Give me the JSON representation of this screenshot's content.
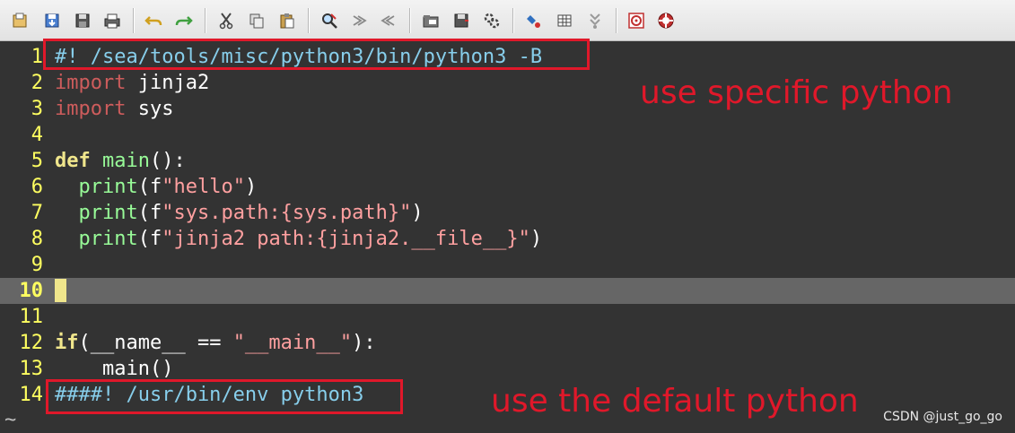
{
  "toolbar": {
    "icons": [
      "open-icon",
      "save-icon",
      "save-all-icon",
      "print-icon",
      "undo-icon",
      "redo-icon",
      "cut-icon",
      "copy-icon",
      "paste-icon",
      "find-replace-icon",
      "find-next-icon",
      "find-prev-icon",
      "load-session-icon",
      "save-session-icon",
      "run-script-icon",
      "make-icon",
      "ctags-icon",
      "jump-tag-icon",
      "help-icon",
      "find-help-icon"
    ]
  },
  "editor": {
    "cursor_line": 10,
    "lines": [
      {
        "n": "1",
        "tokens": [
          {
            "t": "#!",
            "c": "com"
          },
          {
            "t": " /sea/tools/misc/python3/bin/python3 -B",
            "c": "com"
          }
        ]
      },
      {
        "n": "2",
        "tokens": [
          {
            "t": "import",
            "c": "pp"
          },
          {
            "t": " jinja2",
            "c": "punct"
          }
        ]
      },
      {
        "n": "3",
        "tokens": [
          {
            "t": "import",
            "c": "pp"
          },
          {
            "t": " sys",
            "c": "punct"
          }
        ]
      },
      {
        "n": "4",
        "tokens": []
      },
      {
        "n": "5",
        "tokens": [
          {
            "t": "def",
            "c": "kw"
          },
          {
            "t": " ",
            "c": "punct"
          },
          {
            "t": "main",
            "c": "fn"
          },
          {
            "t": "():",
            "c": "punct"
          }
        ]
      },
      {
        "n": "6",
        "tokens": [
          {
            "t": "  ",
            "c": "punct"
          },
          {
            "t": "print",
            "c": "fn"
          },
          {
            "t": "(f",
            "c": "punct"
          },
          {
            "t": "\"hello\"",
            "c": "str"
          },
          {
            "t": ")",
            "c": "punct"
          }
        ]
      },
      {
        "n": "7",
        "tokens": [
          {
            "t": "  ",
            "c": "punct"
          },
          {
            "t": "print",
            "c": "fn"
          },
          {
            "t": "(f",
            "c": "punct"
          },
          {
            "t": "\"sys.path:{sys.path}\"",
            "c": "str"
          },
          {
            "t": ")",
            "c": "punct"
          }
        ]
      },
      {
        "n": "8",
        "tokens": [
          {
            "t": "  ",
            "c": "punct"
          },
          {
            "t": "print",
            "c": "fn"
          },
          {
            "t": "(f",
            "c": "punct"
          },
          {
            "t": "\"jinja2 path:{jinja2.__file__}\"",
            "c": "str"
          },
          {
            "t": ")",
            "c": "punct"
          }
        ]
      },
      {
        "n": "9",
        "tokens": []
      },
      {
        "n": "10",
        "tokens": []
      },
      {
        "n": "11",
        "tokens": []
      },
      {
        "n": "12",
        "tokens": [
          {
            "t": "if",
            "c": "kw"
          },
          {
            "t": "(__name__ == ",
            "c": "punct"
          },
          {
            "t": "\"__main__\"",
            "c": "str"
          },
          {
            "t": "):",
            "c": "punct"
          }
        ]
      },
      {
        "n": "13",
        "tokens": [
          {
            "t": "    main()",
            "c": "punct"
          }
        ]
      },
      {
        "n": "14",
        "tokens": [
          {
            "t": "####! /usr/bin/env python3",
            "c": "com"
          }
        ]
      }
    ]
  },
  "statusbar": {
    "tilde": "~"
  },
  "annotations": {
    "specific": "use specific python",
    "default": "use the default python"
  },
  "watermark": "CSDN @just_go_go",
  "colors": {
    "annotation": "#e0182a",
    "background": "#333333",
    "line_number": "#ffff60",
    "comment": "#87ceeb",
    "keyword": "#f0e68c",
    "function": "#98fb98",
    "string": "#ffa0a0",
    "preproc": "#cd5c5c"
  }
}
